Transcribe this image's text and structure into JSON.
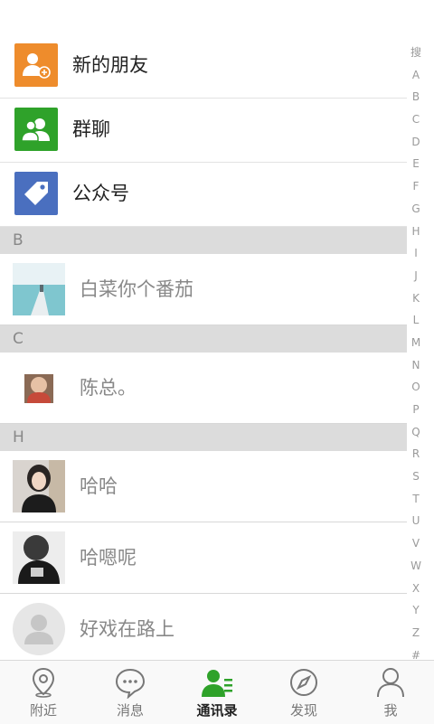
{
  "fixed_items": [
    {
      "label": "新的朋友",
      "icon": "add-friend-icon",
      "color": "#ee8c2c"
    },
    {
      "label": "群聊",
      "icon": "group-chat-icon",
      "color": "#2fa22a"
    },
    {
      "label": "公众号",
      "icon": "tag-icon",
      "color": "#4a6fbf"
    }
  ],
  "sections": [
    {
      "letter": "B",
      "contacts": [
        {
          "name": "白菜你个番茄"
        }
      ]
    },
    {
      "letter": "C",
      "contacts": [
        {
          "name": "陈总。"
        }
      ]
    },
    {
      "letter": "H",
      "contacts": [
        {
          "name": "哈哈"
        },
        {
          "name": "哈嗯呢"
        },
        {
          "name": "好戏在路上"
        }
      ]
    }
  ],
  "index_bar": [
    "搜",
    "A",
    "B",
    "C",
    "D",
    "E",
    "F",
    "G",
    "H",
    "I",
    "J",
    "K",
    "L",
    "M",
    "N",
    "O",
    "P",
    "Q",
    "R",
    "S",
    "T",
    "U",
    "V",
    "W",
    "X",
    "Y",
    "Z",
    "#"
  ],
  "tabs": [
    {
      "label": "附近",
      "icon": "location-pin-icon"
    },
    {
      "label": "消息",
      "icon": "chat-bubble-icon"
    },
    {
      "label": "通讯录",
      "icon": "contacts-icon",
      "active": true
    },
    {
      "label": "发现",
      "icon": "compass-icon"
    },
    {
      "label": "我",
      "icon": "person-icon"
    }
  ],
  "colors": {
    "accent": "#2fa22a",
    "section_bg": "#dcdcdc",
    "tabbar_bg": "#f9f9f9"
  }
}
